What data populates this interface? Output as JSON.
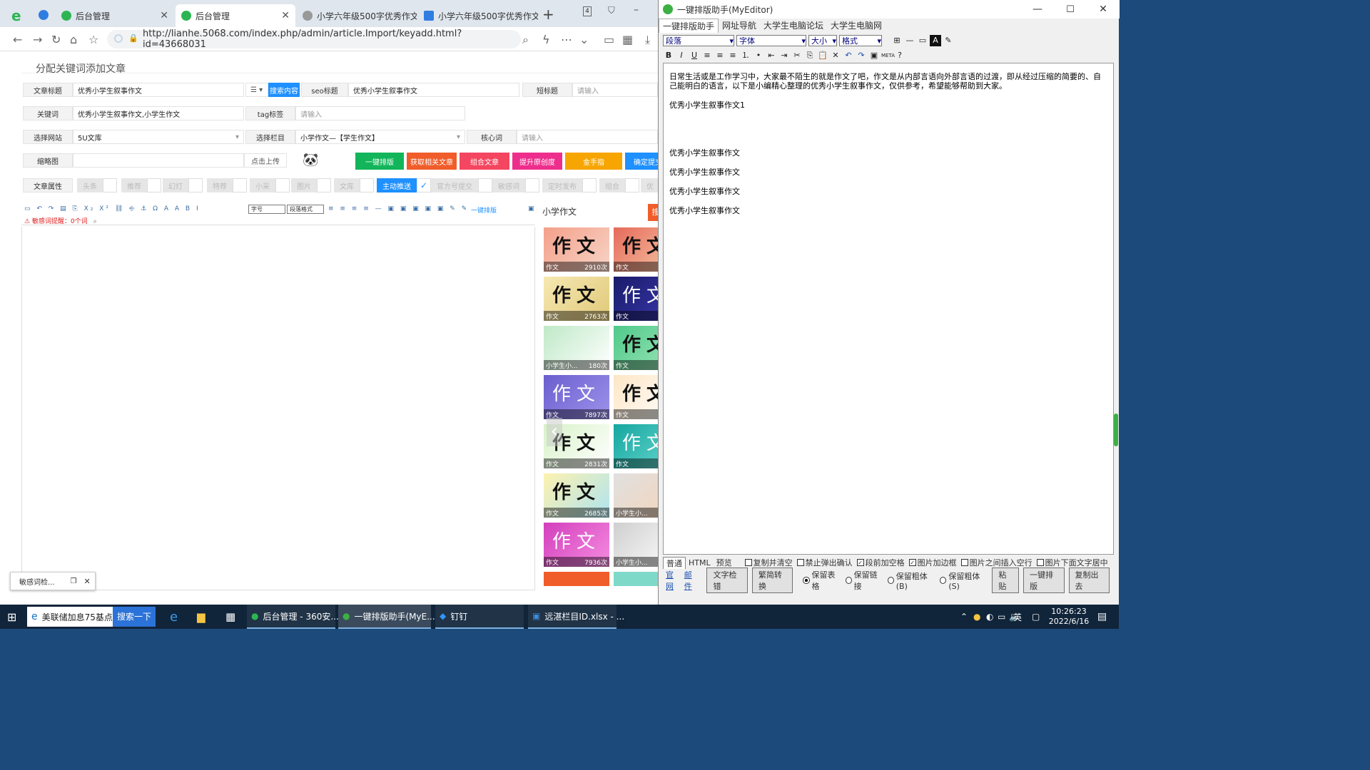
{
  "browser": {
    "tabs": [
      {
        "label": "后台管理",
        "active": false
      },
      {
        "label": "后台管理",
        "active": true
      },
      {
        "label": "小学六年级500字优秀作文",
        "active": false
      },
      {
        "label": "小学六年级500字优秀作文",
        "active": false
      }
    ],
    "tab_count": "4",
    "url": "http://lianhe.5068.com/index.php/admin/article.Import/keyadd.html?id=43668031"
  },
  "page": {
    "title": "分配关键词添加文章",
    "row1": {
      "title_label": "文章标题",
      "title_value": "优秀小学生叙事作文",
      "search_btn": "搜索内容",
      "seo_label": "seo标题",
      "seo_value": "优秀小学生叙事作文",
      "short_label": "短标题",
      "short_placeholder": "请输入"
    },
    "row2": {
      "kw_label": "关键词",
      "kw_value": "优秀小学生叙事作文,小学生作文",
      "tag_label": "tag标签",
      "tag_placeholder": "请输入"
    },
    "row3": {
      "site_label": "选择网站",
      "site_value": "5U文库",
      "col_label": "选择栏目",
      "col_value": "小学作文—【学生作文】",
      "core_label": "核心词",
      "core_placeholder": "请输入"
    },
    "row4": {
      "thumb_label": "缩略图",
      "upload_btn": "点击上传",
      "buttons": [
        "一键排版",
        "获取相关文章",
        "组合文章",
        "提升原创度",
        "金手指",
        "确定提交"
      ]
    },
    "attr": {
      "label": "文章属性",
      "items": [
        "头条",
        "推荐",
        "幻灯",
        "特荐",
        "小采",
        "图片",
        "文库",
        "主动推送",
        "官方号提交",
        "敏感词",
        "定时发布",
        "组合",
        "优"
      ]
    },
    "editor": {
      "font_select": "字号",
      "format_select": "段落格式",
      "one_key": "一键排版",
      "sensitive": "敏感词提醒：0个词"
    },
    "side": {
      "search_value": "小学作文",
      "search_btn": "搜",
      "thumbs": [
        {
          "big": "作文",
          "cap": "作文",
          "count": "2910次"
        },
        {
          "big": "作文",
          "cap": "作文",
          "count": ""
        },
        {
          "big": "作文",
          "cap": "作文",
          "count": "2763次"
        },
        {
          "big": "作文",
          "cap": "作文",
          "count": ""
        },
        {
          "big": "",
          "cap": "小学生小...",
          "count": "180次"
        },
        {
          "big": "作文",
          "cap": "作文",
          "count": ""
        },
        {
          "big": "作文",
          "cap": "作文",
          "count": "7897次"
        },
        {
          "big": "作文",
          "cap": "作文",
          "count": ""
        },
        {
          "big": "作文",
          "cap": "作文",
          "count": "2831次"
        },
        {
          "big": "作文",
          "cap": "作文",
          "count": ""
        },
        {
          "big": "作文",
          "cap": "作文",
          "count": "2685次"
        },
        {
          "big": "",
          "cap": "小学生小...",
          "count": ""
        },
        {
          "big": "作文",
          "cap": "作文",
          "count": "7936次"
        },
        {
          "big": "",
          "cap": "小学生小...",
          "count": ""
        }
      ]
    },
    "popup": "敏感词检..."
  },
  "myeditor": {
    "title": "一键排版助手(MyEditor)",
    "menu": [
      "一键排版助手",
      "网址导航",
      "大学生电脑论坛",
      "大学生电脑网"
    ],
    "selects": [
      "段落",
      "字体",
      "大小",
      "格式"
    ],
    "content": [
      "日常生活或是工作学习中，大家最不陌生的就是作文了吧，作文是从内部言语向外部言语的过渡，即从经过压缩的简要的、自己能明白的语言，以下是小编精心整理的优秀小学生叙事作文，仅供参考，希望能够帮助到大家。",
      "优秀小学生叙事作文1",
      "",
      "优秀小学生叙事作文",
      "优秀小学生叙事作文",
      "优秀小学生叙事作文",
      "优秀小学生叙事作文"
    ],
    "view_tabs": [
      "普通",
      "HTML",
      "预览"
    ],
    "options": [
      {
        "label": "复制并清空",
        "checked": false
      },
      {
        "label": "禁止弹出确认",
        "checked": false
      },
      {
        "label": "段前加空格",
        "checked": true
      },
      {
        "label": "图片加边框",
        "checked": true
      },
      {
        "label": "图片之间插入空行",
        "checked": false
      },
      {
        "label": "图片下面文字居中",
        "checked": false
      }
    ],
    "links": [
      "官网",
      "邮件"
    ],
    "buttons": [
      "文字检错",
      "繁简转换",
      "粘贴",
      "一键排版",
      "复制出去"
    ],
    "radios": [
      {
        "label": "保留表格",
        "checked": true
      },
      {
        "label": "保留链接",
        "checked": false
      },
      {
        "label": "保留粗体(B)",
        "checked": false
      },
      {
        "label": "保留粗体(S)",
        "checked": false
      }
    ]
  },
  "taskbar": {
    "search_text": "美联储加息75基点",
    "search_btn": "搜索一下",
    "items": [
      "后台管理 - 360安...",
      "一键排版助手(MyE...",
      "钉钉",
      "远湛栏目ID.xlsx - ..."
    ],
    "ime": "英",
    "time": "10:26:23",
    "date": "2022/6/16"
  },
  "colors": {
    "green": "#12b55a",
    "orange": "#f05d2a",
    "red": "#f44660",
    "pink": "#ee2e8c",
    "yellow": "#f7a500",
    "blue": "#1e90ff"
  }
}
